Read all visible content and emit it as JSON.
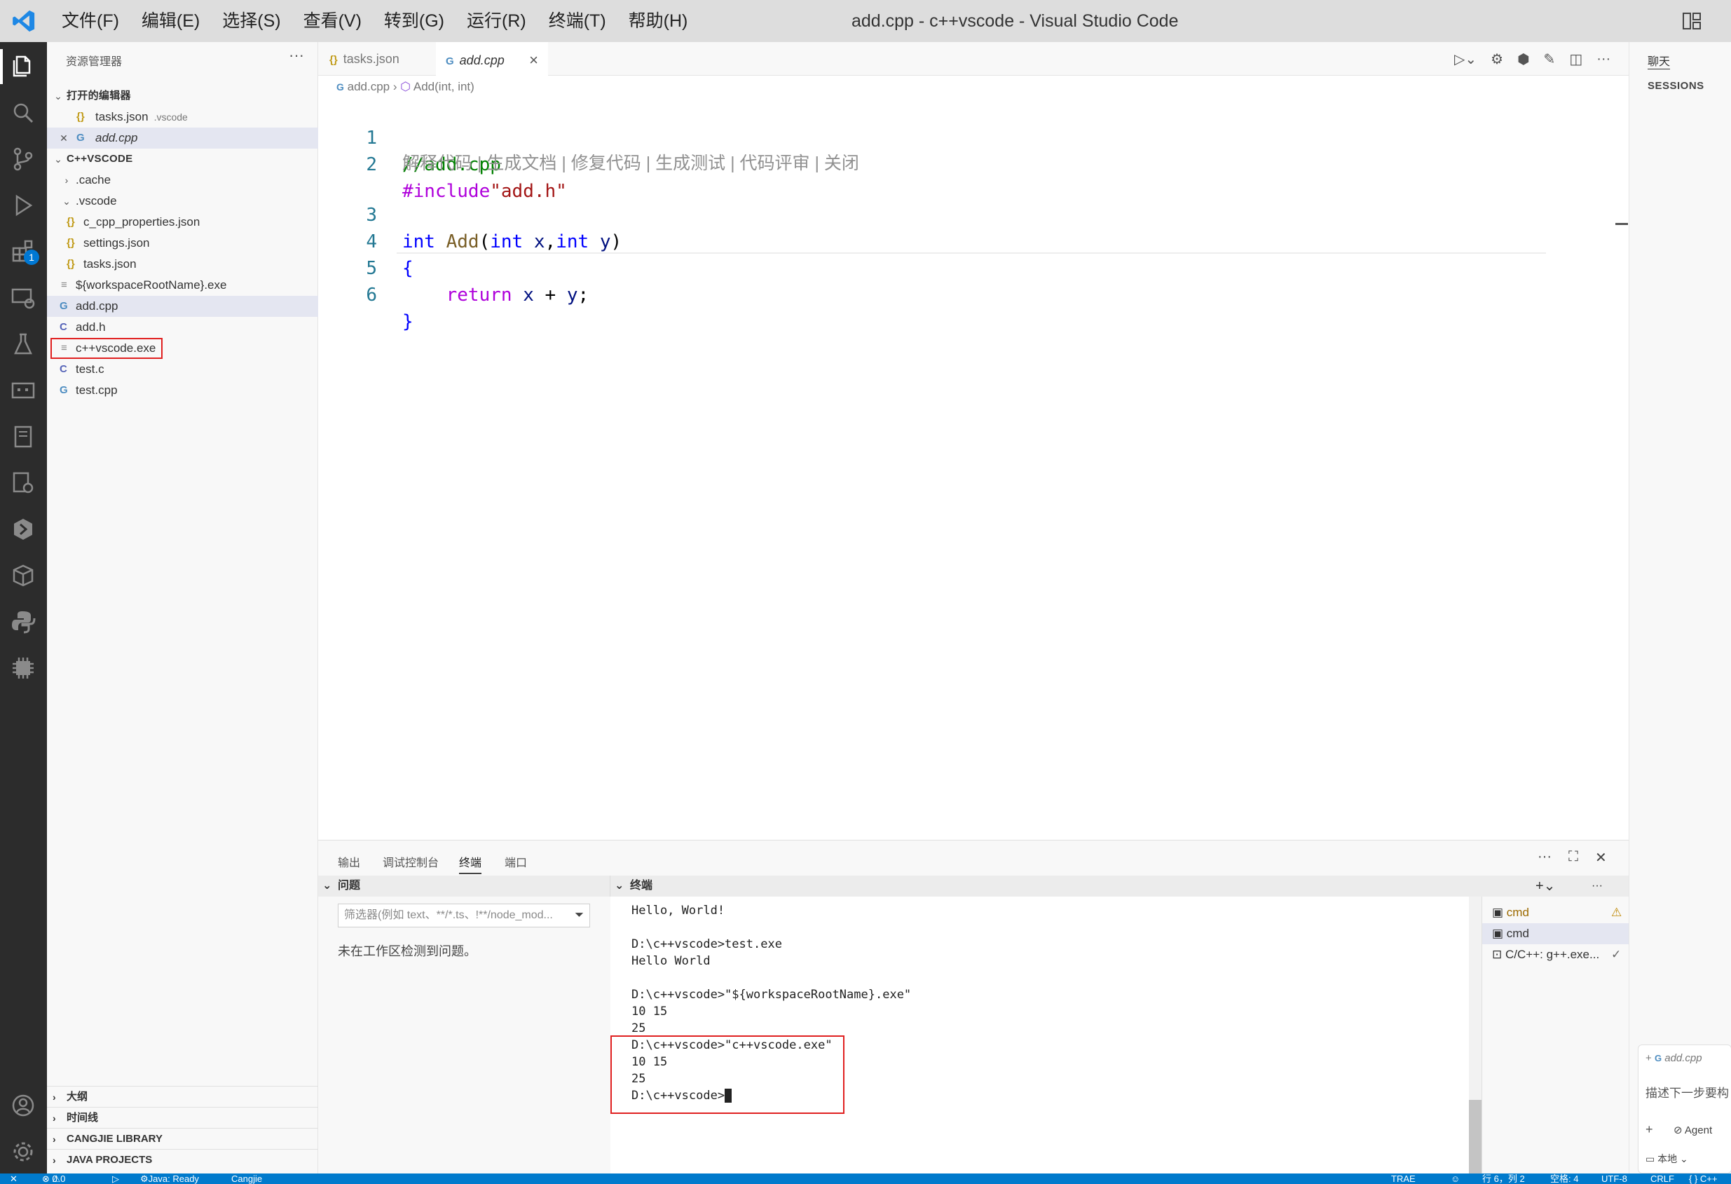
{
  "app": {
    "menu": [
      "文件(F)",
      "编辑(E)",
      "选择(S)",
      "查看(V)",
      "转到(G)",
      "运行(R)",
      "终端(T)",
      "帮助(H)"
    ],
    "window_title": "add.cpp - c++vscode - Visual Studio Code",
    "accent_color": "#007acc"
  },
  "activity_bar": {
    "items": [
      "explorer-icon",
      "search-icon",
      "source-control-icon",
      "run-debug-icon",
      "extensions-icon",
      "remote-explorer-icon",
      "testing-icon",
      "ports-icon",
      "notebook-icon",
      "settings-sync-icon",
      "cangjie-icon",
      "packages-icon",
      "python-icon",
      "chip-icon"
    ],
    "extensions_badge": "1",
    "bottom": [
      "account-icon",
      "manage-gear-icon"
    ]
  },
  "sidebar": {
    "title": "资源管理器",
    "more": "···",
    "open_editors_title": "打开的编辑器",
    "open_editors": [
      {
        "name": "tasks.json",
        "hint": ".vscode"
      },
      {
        "name": "add.cpp",
        "hint": ""
      }
    ],
    "workspace_title": "C++VSCODE",
    "tree": [
      {
        "name": ".cache",
        "type": "folder"
      },
      {
        "name": ".vscode",
        "type": "folder-open"
      },
      {
        "name": "c_cpp_properties.json",
        "type": "json"
      },
      {
        "name": "settings.json",
        "type": "json"
      },
      {
        "name": "tasks.json",
        "type": "json"
      },
      {
        "name": "${workspaceRootName}.exe",
        "type": "exe"
      },
      {
        "name": "add.cpp",
        "type": "cpp"
      },
      {
        "name": "add.h",
        "type": "c"
      },
      {
        "name": "c++vscode.exe",
        "type": "exe"
      },
      {
        "name": "test.c",
        "type": "c"
      },
      {
        "name": "test.cpp",
        "type": "cpp"
      }
    ],
    "bottom_sections": [
      "大纲",
      "时间线",
      "CANGJIE LIBRARY",
      "JAVA PROJECTS"
    ]
  },
  "editor": {
    "tabs": [
      {
        "label": "tasks.json",
        "active": false
      },
      {
        "label": "add.cpp",
        "active": true
      }
    ],
    "breadcrumb": {
      "file": "add.cpp",
      "symbol": "Add(int, int)"
    },
    "line_numbers": [
      "1",
      "2",
      "3",
      "4",
      "5",
      "6"
    ],
    "lines": [
      "//add.cpp",
      "#include\"add.h\"",
      "int Add(int x,int y)",
      "{",
      "    return x + y;",
      "}"
    ],
    "codelens": "解释代码 | 生成文档 | 修复代码 | 生成测试 | 代码评审 | 关闭"
  },
  "chat": {
    "tab": "聊天",
    "sessions_title": "SESSIONS",
    "context_file": "add.cpp",
    "placeholder": "描述下一步要构",
    "mode": "Agent",
    "location": "本地"
  },
  "panel": {
    "tabs": [
      "输出",
      "调试控制台",
      "终端",
      "端口"
    ],
    "active_tab": "终端",
    "problems_title": "问题",
    "filter_placeholder": "筛选器(例如 text、**/*.ts、!**/node_mod...",
    "no_problems": "未在工作区检测到问题。",
    "terminal_title": "终端",
    "terminal_lines": [
      "Hello, World!",
      "",
      "D:\\c++vscode>test.exe",
      "Hello World",
      "",
      "D:\\c++vscode>\"${workspaceRootName}.exe\"",
      "10 15",
      "25",
      "D:\\c++vscode>\"c++vscode.exe\"",
      "10 15",
      "25",
      "D:\\c++vscode>"
    ],
    "terminals": [
      {
        "name": "cmd",
        "status": "warning"
      },
      {
        "name": "cmd",
        "status": ""
      },
      {
        "name": "C/C++: g++.exe...",
        "status": "done"
      }
    ]
  },
  "statusbar": {
    "errors": "0",
    "warnings": "0",
    "java": "Java: Ready",
    "cangjie": "Cangjie",
    "trae": "TRAE",
    "position": "行 6，列 2",
    "spaces": "空格: 4",
    "encoding": "UTF-8",
    "eol": "CRLF",
    "language": "{ } C++"
  }
}
